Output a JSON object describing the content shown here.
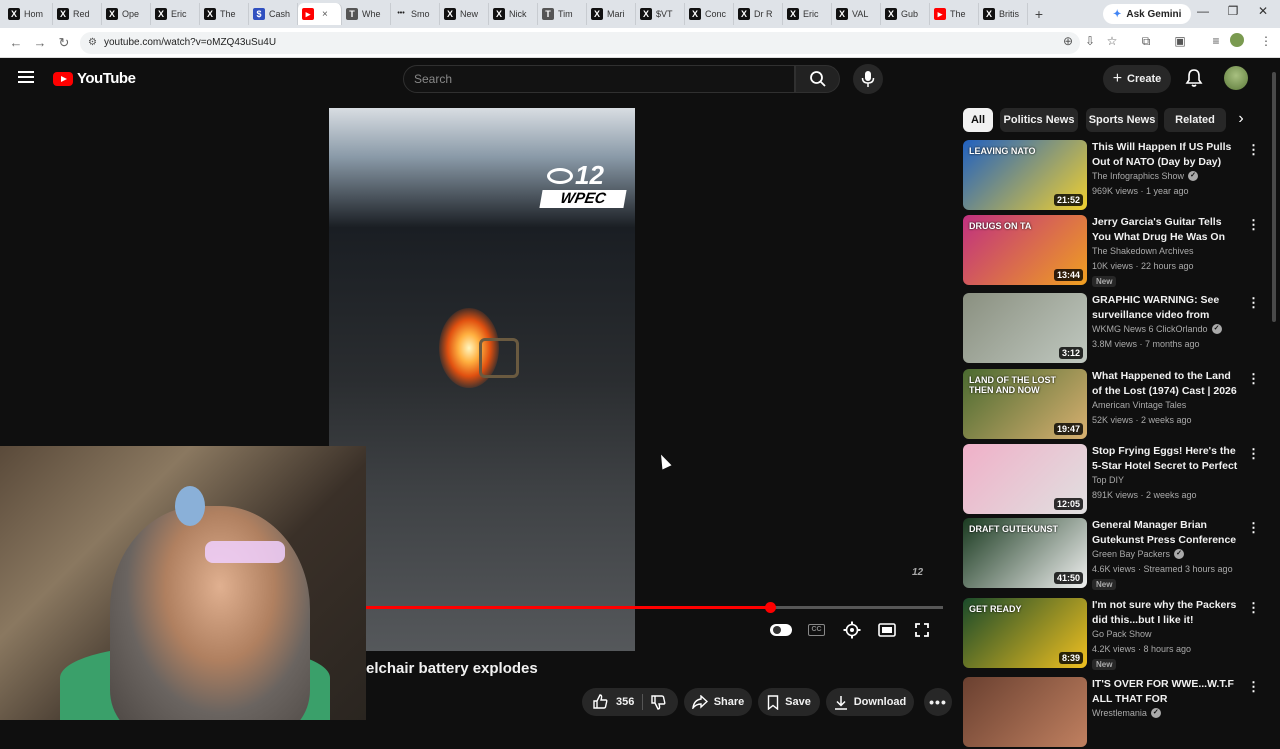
{
  "browser": {
    "tabs": [
      {
        "label": "Hom",
        "icon": "x-icon"
      },
      {
        "label": "Red",
        "icon": "x-icon"
      },
      {
        "label": "Ope",
        "icon": "x-icon"
      },
      {
        "label": "Eric",
        "icon": "x-icon"
      },
      {
        "label": "The",
        "icon": "x-icon"
      },
      {
        "label": "Cash",
        "icon": "cash-icon"
      },
      {
        "label": "",
        "icon": "youtube-icon",
        "active": true,
        "close": "×"
      },
      {
        "label": "Whe",
        "icon": "tab-icon"
      },
      {
        "label": "Smo",
        "icon": "dots-icon"
      },
      {
        "label": "New",
        "icon": "x-icon"
      },
      {
        "label": "Nick",
        "icon": "x-icon"
      },
      {
        "label": "Tim",
        "icon": "tab-icon"
      },
      {
        "label": "Mari",
        "icon": "x-icon"
      },
      {
        "label": "$VT",
        "icon": "x-icon"
      },
      {
        "label": "Conc",
        "icon": "x-icon"
      },
      {
        "label": "Dr R",
        "icon": "x-icon"
      },
      {
        "label": "Eric",
        "icon": "x-icon"
      },
      {
        "label": "VAL",
        "icon": "x-icon"
      },
      {
        "label": "Gub",
        "icon": "x-icon"
      },
      {
        "label": "The",
        "icon": "youtube-icon"
      },
      {
        "label": "Britis",
        "icon": "x-icon"
      }
    ],
    "new_tab": "+",
    "gemini_label": "Ask Gemini",
    "url": "youtube.com/watch?v=oMZQ43uSu4U"
  },
  "header": {
    "logo_text": "YouTube",
    "search_placeholder": "Search",
    "create_label": "Create"
  },
  "video": {
    "title": "elchair battery explodes",
    "station_number": "12",
    "station_call": "WPEC",
    "progress": 0.7
  },
  "actions": {
    "like_count": "356",
    "share_label": "Share",
    "save_label": "Save",
    "download_label": "Download"
  },
  "chips": [
    "All",
    "Politics News",
    "Sports News",
    "Related"
  ],
  "recommendations": [
    {
      "title": "This Will Happen If US Pulls Out of NATO (Day by Day)",
      "channel": "The Infographics Show",
      "verified": true,
      "meta": "969K views · 1 year ago",
      "duration": "21:52",
      "thumb_text": "LEAVING NATO",
      "thumb_colors": [
        "#2060c0",
        "#f0d030"
      ],
      "badge": ""
    },
    {
      "title": "Jerry Garcia's Guitar Tells You What Drug He Was On",
      "channel": "The Shakedown Archives",
      "verified": false,
      "meta": "10K views · 22 hours ago",
      "duration": "13:44",
      "thumb_text": "DRUGS ON TA",
      "thumb_colors": [
        "#c03080",
        "#f0a020"
      ],
      "badge": "New"
    },
    {
      "title": "GRAPHIC WARNING: See surveillance video from Centra...",
      "channel": "WKMG News 6 ClickOrlando",
      "verified": true,
      "meta": "3.8M views · 7 months ago",
      "duration": "3:12",
      "thumb_text": "",
      "thumb_colors": [
        "#8a9080",
        "#c0c8c0"
      ],
      "badge": ""
    },
    {
      "title": "What Happened to the Land of the Lost (1974) Cast | 2026 ...",
      "channel": "American Vintage Tales",
      "verified": false,
      "meta": "52K views · 2 weeks ago",
      "duration": "19:47",
      "thumb_text": "LAND OF THE LOST THEN AND NOW",
      "thumb_colors": [
        "#4a6a30",
        "#d8b070"
      ],
      "badge": ""
    },
    {
      "title": "Stop Frying Eggs! Here's the 5-Star Hotel Secret to Perfect ...",
      "channel": "Top DIY",
      "verified": false,
      "meta": "891K views · 2 weeks ago",
      "duration": "12:05",
      "thumb_text": "",
      "thumb_colors": [
        "#f0b0c8",
        "#e0e0e0"
      ],
      "badge": ""
    },
    {
      "title": "General Manager Brian Gutekunst Press Conference",
      "channel": "Green Bay Packers",
      "verified": true,
      "meta": "4.6K views · Streamed 3 hours ago",
      "duration": "41:50",
      "thumb_text": "DRAFT GUTEKUNST",
      "thumb_colors": [
        "#1a3a20",
        "#f0f0f0"
      ],
      "badge": "New"
    },
    {
      "title": "I'm not sure why the Packers did this...but I like it!",
      "channel": "Go Pack Show",
      "verified": false,
      "meta": "4.2K views · 8 hours ago",
      "duration": "8:39",
      "thumb_text": "GET READY",
      "thumb_colors": [
        "#1a4a2a",
        "#f0c020"
      ],
      "badge": "New"
    },
    {
      "title": "IT'S OVER FOR WWE...W.T.F ALL THAT FOR NOTHING...FREAK ...",
      "channel": "Wrestlemania",
      "verified": true,
      "meta": "",
      "duration": "",
      "thumb_text": "",
      "thumb_colors": [
        "#6a4030",
        "#c08060"
      ],
      "badge": ""
    }
  ],
  "colors": {
    "accent": "#ff0000",
    "background": "#0f0f0f",
    "chip_bg": "#272727"
  }
}
